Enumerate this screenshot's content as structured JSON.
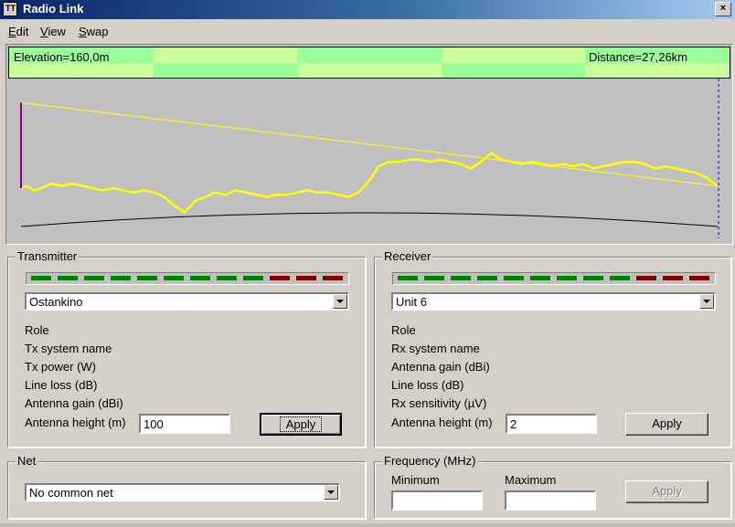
{
  "window": {
    "title": "Radio Link",
    "close_glyph": "×",
    "icon_text": "TT"
  },
  "menu": [
    {
      "label": "Edit",
      "accel": "E",
      "rest": "dit"
    },
    {
      "label": "View",
      "accel": "V",
      "rest": "iew"
    },
    {
      "label": "Swap",
      "accel": "S",
      "rest": "wap"
    }
  ],
  "profile": {
    "elevation": "Elevation=160,0m",
    "distance": "Distance=27,26km",
    "colors": {
      "strip_a": "#99ff99",
      "strip_b": "#ccff99",
      "background": "#c0c0c0",
      "terrain": "#ffff00",
      "sightline": "#ffff00",
      "earth_curve": "#000000",
      "tx_antenna": "#800080",
      "rx_marker": "#0000ff"
    }
  },
  "chart_data": {
    "type": "line",
    "title": "",
    "xlabel": "",
    "ylabel": "",
    "xlim": [
      0,
      27.26
    ],
    "series": [
      {
        "values_x": [
          0,
          0.2,
          0.5,
          0.8,
          1.2,
          1.6,
          2.0,
          2.4,
          2.8,
          3.2,
          3.6,
          4.0,
          4.4,
          4.8,
          5.2,
          5.6,
          6.0,
          6.4,
          6.8,
          7.2,
          7.6,
          8.0,
          8.4,
          8.8,
          9.2,
          9.6,
          10.0,
          10.4,
          10.8,
          11.2,
          11.6,
          12.0,
          12.4,
          12.8,
          13.2,
          13.6,
          14.0,
          14.4,
          14.8,
          15.2,
          15.6,
          16.0,
          16.4,
          16.8,
          17.2,
          17.6,
          18.0,
          18.4,
          18.8,
          19.2,
          19.6,
          20.0,
          20.4,
          20.8,
          21.2,
          21.6,
          22.0,
          22.4,
          22.8,
          23.2,
          23.6,
          24.0,
          24.4,
          24.8,
          25.2,
          25.6,
          26.0,
          26.4,
          26.8,
          27.26
        ],
        "values_y": [
          85,
          86,
          84,
          85,
          87,
          86,
          87,
          86,
          85,
          84,
          85,
          84,
          83,
          84,
          83,
          81,
          77,
          74,
          79,
          81,
          83,
          82,
          84,
          83,
          82,
          81,
          82,
          82,
          83,
          84,
          83,
          83,
          82,
          81,
          83,
          88,
          95,
          97,
          97,
          98,
          98,
          97,
          98,
          97,
          96,
          94,
          97,
          101,
          98,
          97,
          96,
          97,
          96,
          95,
          96,
          95,
          96,
          94,
          95,
          96,
          97,
          97,
          96,
          94,
          95,
          94,
          93,
          92,
          90,
          86
        ]
      }
    ],
    "sightline": {
      "from": [
        0,
        124
      ],
      "to": [
        27.26,
        86
      ]
    },
    "ylim": [
      60,
      135
    ]
  },
  "transmitter": {
    "legend": "Transmitter",
    "site": "Ostankino",
    "labels": [
      "Role",
      "Tx system name",
      "Tx power (W)",
      "Line loss (dB)",
      "Antenna gain (dBi)"
    ],
    "antenna_height_label": "Antenna height (m)",
    "antenna_height_value": "100",
    "apply_label": "Apply",
    "level": {
      "green": 9,
      "red": 3
    }
  },
  "receiver": {
    "legend": "Receiver",
    "site": "Unit 6",
    "labels": [
      "Role",
      "Rx system name",
      "Antenna gain (dBi)",
      "Line loss (dB)",
      "Rx sensitivity (µV)"
    ],
    "antenna_height_label": "Antenna height (m)",
    "antenna_height_value": "2",
    "apply_label": "Apply",
    "level": {
      "green": 9,
      "red": 3
    }
  },
  "net": {
    "legend": "Net",
    "value": "No common net"
  },
  "frequency": {
    "legend": "Frequency (MHz)",
    "min_label": "Minimum",
    "max_label": "Maximum",
    "min_value": "",
    "max_value": "",
    "apply_label": "Apply"
  },
  "colors": {
    "led_green": "#008000",
    "led_red": "#800000",
    "titlebar": "#0a246a"
  }
}
